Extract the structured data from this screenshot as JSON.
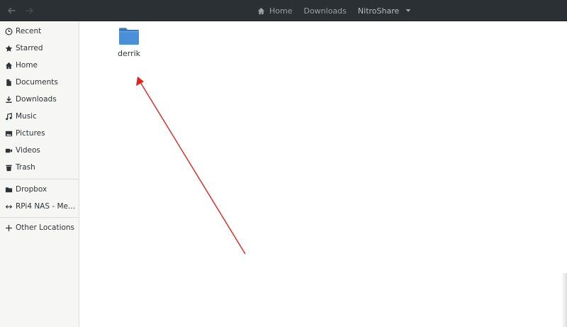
{
  "window": {
    "nav": {
      "back_icon": "arrow-left-icon",
      "forward_icon": "arrow-right-icon"
    },
    "pathbar": {
      "crumbs": [
        "Home",
        "Downloads",
        "NitroShare"
      ],
      "home_icon": "home-icon",
      "menu_icon": "chevron-down-icon"
    }
  },
  "sidebar": {
    "items": [
      {
        "label": "Recent",
        "icon": "clock-icon"
      },
      {
        "label": "Starred",
        "icon": "star-icon"
      },
      {
        "label": "Home",
        "icon": "home-icon"
      },
      {
        "label": "Documents",
        "icon": "document-icon"
      },
      {
        "label": "Downloads",
        "icon": "download-icon"
      },
      {
        "label": "Music",
        "icon": "music-icon"
      },
      {
        "label": "Pictures",
        "icon": "picture-icon"
      },
      {
        "label": "Videos",
        "icon": "video-icon"
      },
      {
        "label": "Trash",
        "icon": "trash-icon"
      },
      {
        "label": "Dropbox",
        "icon": "folder-icon"
      },
      {
        "label": "RPi4 NAS - Me...",
        "icon": "network-share-icon"
      },
      {
        "label": "Other Locations",
        "icon": "plus-icon"
      }
    ]
  },
  "content": {
    "files": [
      {
        "name": "derrik",
        "icon": "folder-icon",
        "color": "#4a90d9"
      }
    ]
  },
  "annotation": {
    "type": "arrow",
    "color": "#e8201a"
  },
  "colors": {
    "headerbar": "#2b3035",
    "sidebar": "#f6f6f5",
    "accent": "#4a90d9"
  }
}
